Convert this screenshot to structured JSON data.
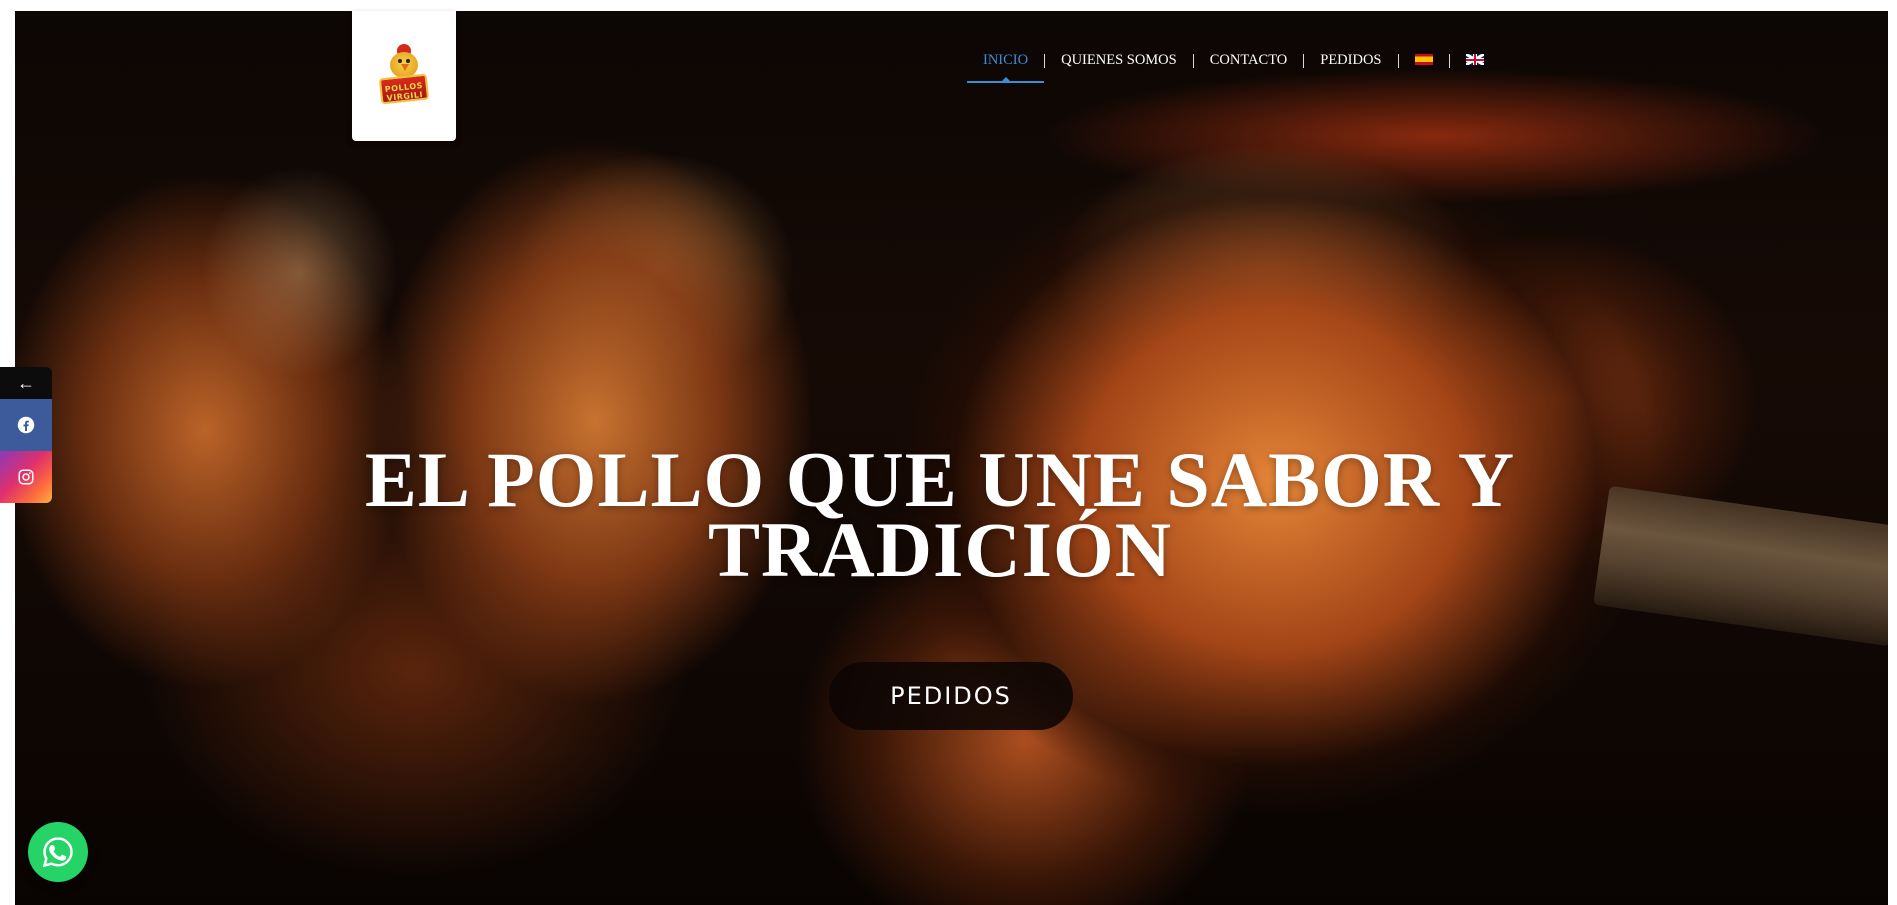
{
  "brand": {
    "logo_text": "POLLOS VIRGILI"
  },
  "nav": {
    "items": [
      {
        "label": "INICIO",
        "active": true
      },
      {
        "label": "QUIENES SOMOS",
        "active": false
      },
      {
        "label": "CONTACTO",
        "active": false
      },
      {
        "label": "PEDIDOS",
        "active": false
      }
    ],
    "languages": [
      {
        "icon": "spain-flag-icon"
      },
      {
        "icon": "uk-flag-icon"
      }
    ],
    "active_color": "#3a8ed8"
  },
  "hero": {
    "title": "EL POLLO QUE UNE SABOR Y TRADICIÓN",
    "button_label": "PEDIDOS"
  },
  "social": {
    "collapse_icon": "arrow-left-icon",
    "items": [
      {
        "icon": "facebook-icon",
        "color": "#3d5a9a"
      },
      {
        "icon": "instagram-icon",
        "color": "#e1306c"
      }
    ]
  },
  "whatsapp": {
    "icon": "whatsapp-icon",
    "color": "#25d366"
  }
}
